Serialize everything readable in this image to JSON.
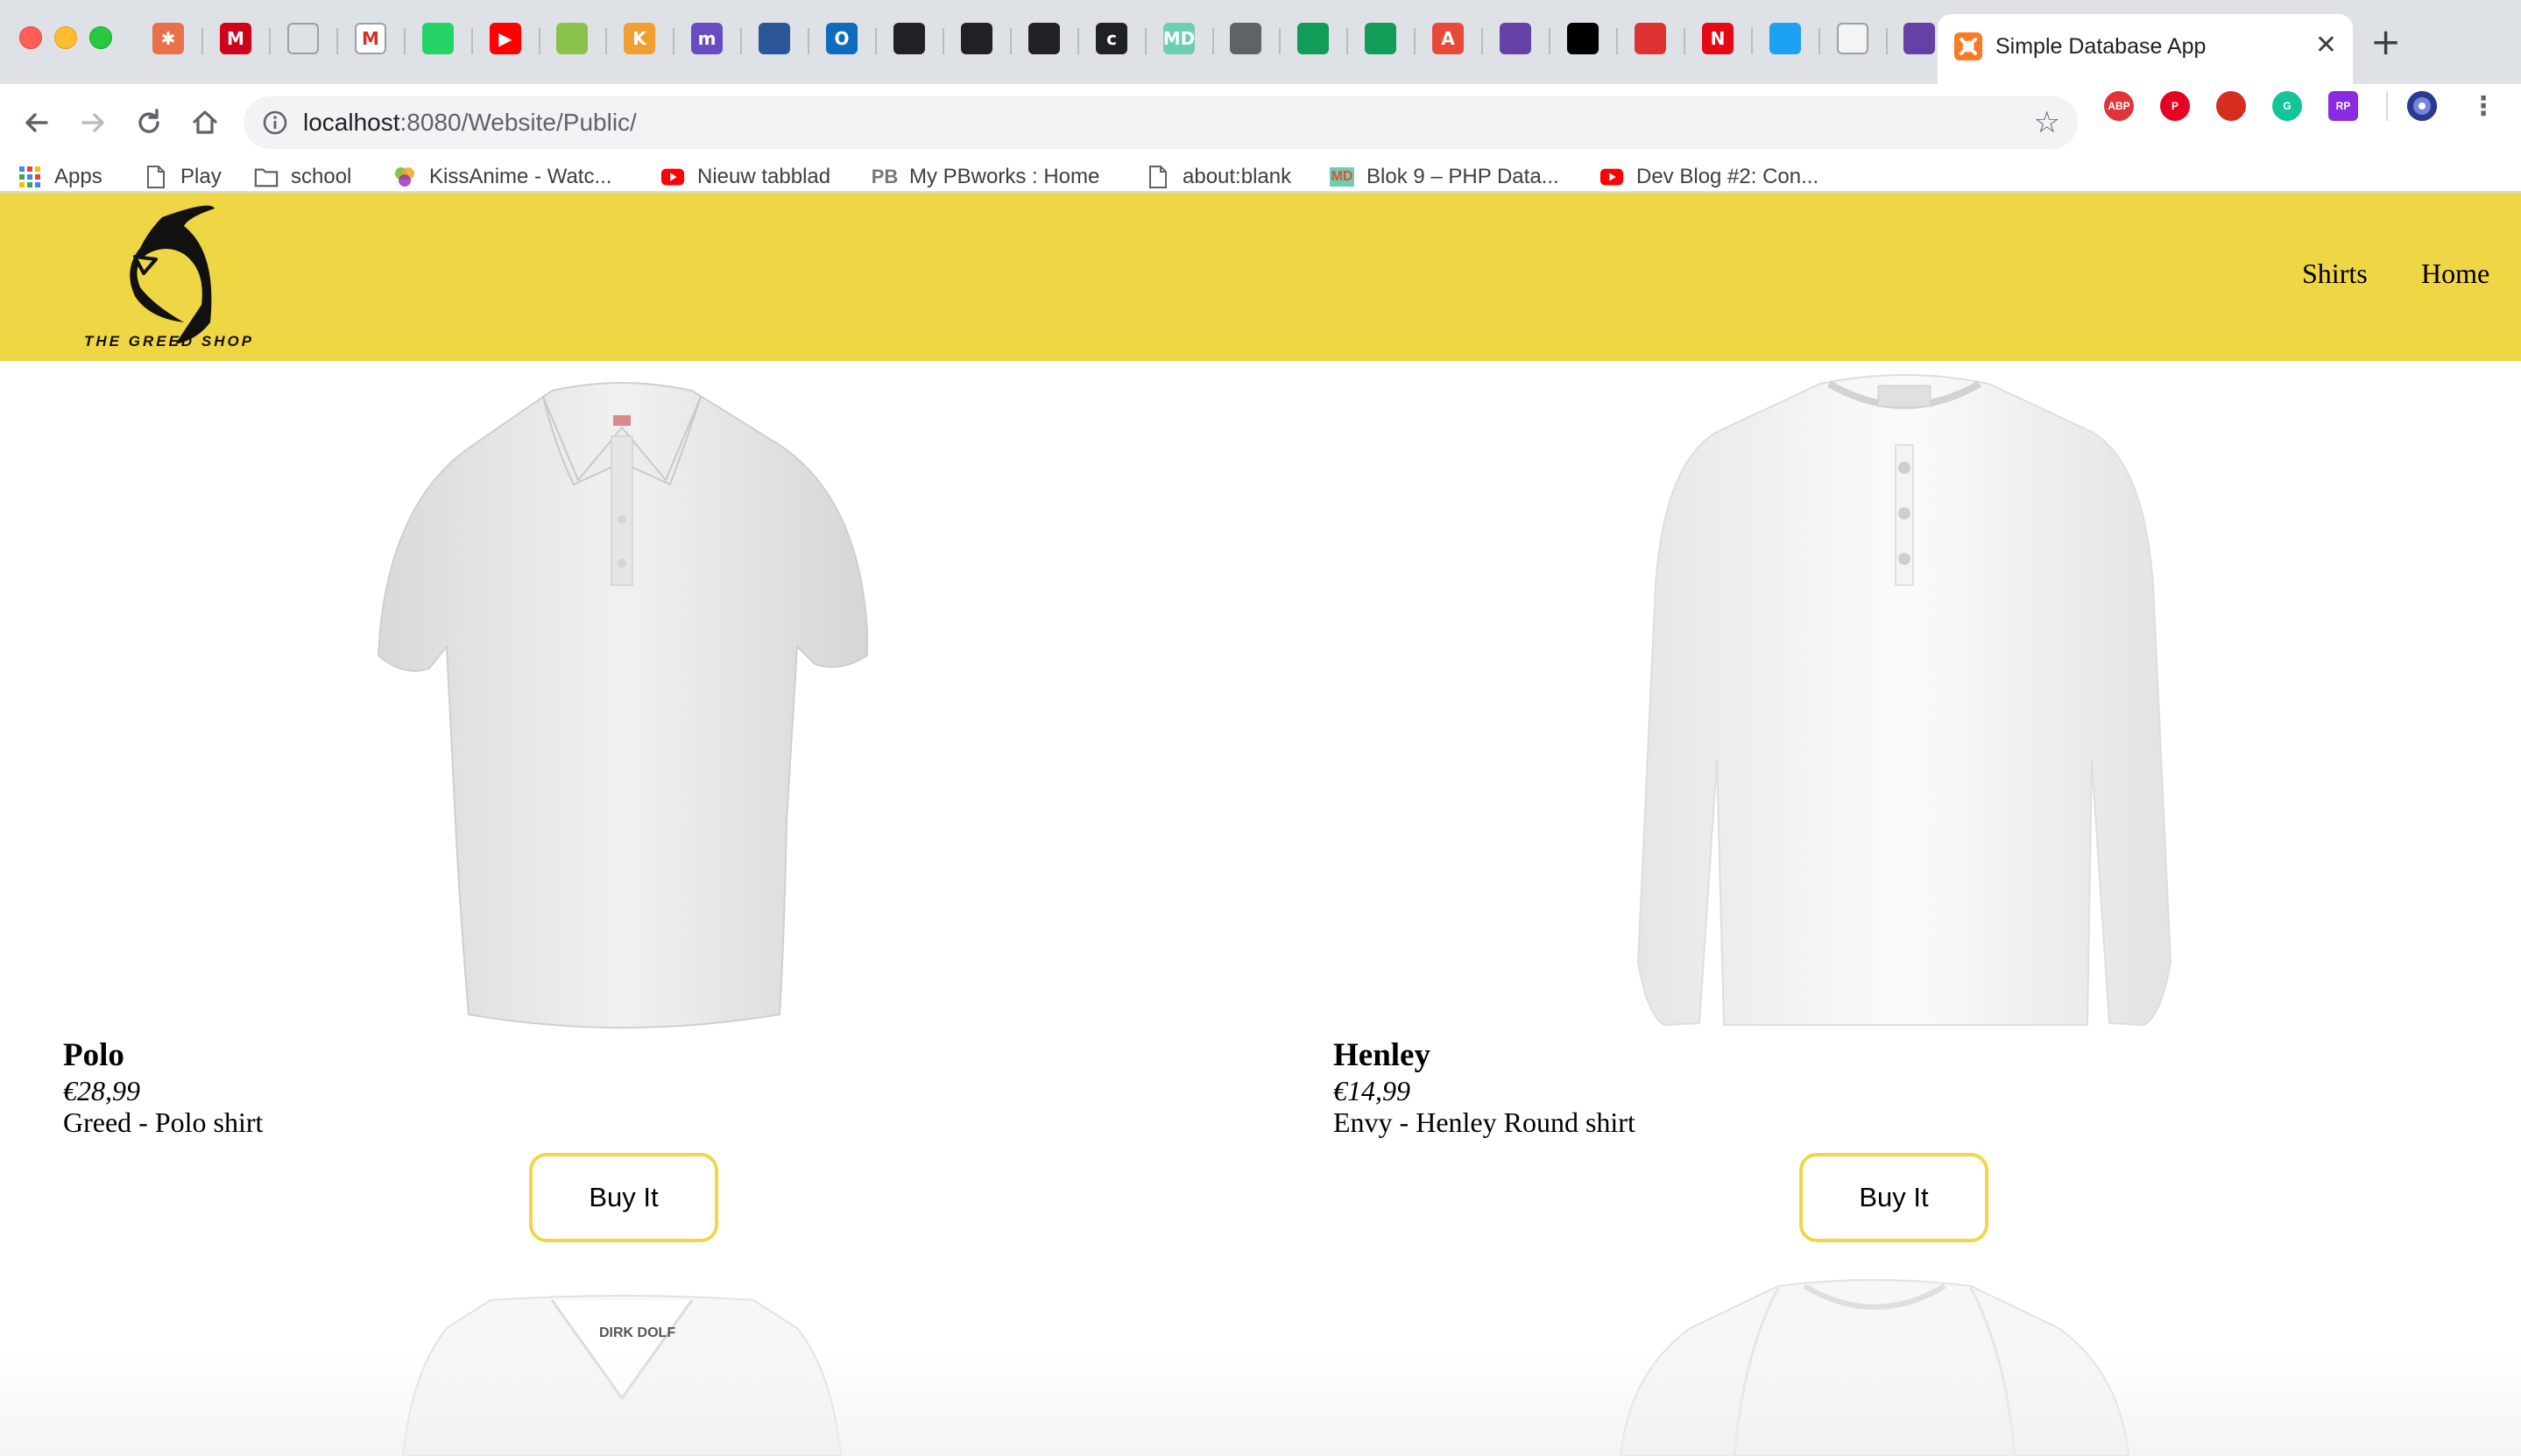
{
  "browser": {
    "pinned_tabs": [
      {
        "icon": "asterisk-app-icon",
        "color": "#e8704a",
        "glyph": "✱"
      },
      {
        "icon": "m-red-icon",
        "color": "#d0021b",
        "glyph": "M"
      },
      {
        "icon": "document-icon",
        "color": "#dee1e6",
        "glyph": ""
      },
      {
        "icon": "gmail-icon",
        "color": "#ffffff",
        "glyph": "M"
      },
      {
        "icon": "whatsapp-icon",
        "color": "#25d366",
        "glyph": ""
      },
      {
        "icon": "youtube-icon",
        "color": "#ff0000",
        "glyph": "▶"
      },
      {
        "icon": "kissanime-icon",
        "color": "#8bc34a",
        "glyph": ""
      },
      {
        "icon": "k-icon",
        "color": "#f0a030",
        "glyph": "K"
      },
      {
        "icon": "m-purple-icon",
        "color": "#6a4bc4",
        "glyph": "m"
      },
      {
        "icon": "blue-book-icon",
        "color": "#2b579a",
        "glyph": ""
      },
      {
        "icon": "outlook-icon",
        "color": "#0f6cbd",
        "glyph": "O"
      },
      {
        "icon": "panel-icon",
        "color": "#202124",
        "glyph": ""
      },
      {
        "icon": "board-icon",
        "color": "#202124",
        "glyph": ""
      },
      {
        "icon": "trello-icon",
        "color": "#202124",
        "glyph": ""
      },
      {
        "icon": "c-terminal-icon",
        "color": "#202124",
        "glyph": "c"
      },
      {
        "icon": "md-icon",
        "color": "#6ccfb0",
        "glyph": "MD"
      },
      {
        "icon": "cube-icon",
        "color": "#5f6368",
        "glyph": ""
      },
      {
        "icon": "sheets-icon",
        "color": "#0f9d58",
        "glyph": ""
      },
      {
        "icon": "sheets-icon-2",
        "color": "#0f9d58",
        "glyph": ""
      },
      {
        "icon": "a-red-icon",
        "color": "#e84a3a",
        "glyph": "A"
      },
      {
        "icon": "twitch-icon",
        "color": "#6441a5",
        "glyph": ""
      },
      {
        "icon": "github-icon",
        "color": "#000000",
        "glyph": ""
      },
      {
        "icon": "record-icon",
        "color": "#d33",
        "glyph": ""
      },
      {
        "icon": "netflix-icon",
        "color": "#e50914",
        "glyph": "N"
      },
      {
        "icon": "twitter-icon",
        "color": "#1da1f2",
        "glyph": ""
      },
      {
        "icon": "face-icon",
        "color": "#f4f4f4",
        "glyph": ""
      },
      {
        "icon": "twitch-icon-2",
        "color": "#6441a5",
        "glyph": ""
      }
    ],
    "active_tab": {
      "title": "Simple Database App"
    },
    "url": {
      "host": "localhost",
      "path": ":8080/Website/Public/"
    },
    "extensions": [
      {
        "icon": "adblock-icon",
        "color": "#e0343a",
        "label": "ABP"
      },
      {
        "icon": "pinterest-icon",
        "color": "#e60023",
        "label": "P"
      },
      {
        "icon": "hand-stop-icon",
        "color": "#d62d20",
        "label": ""
      },
      {
        "icon": "grammarly-icon",
        "color": "#15c39a",
        "label": "G"
      },
      {
        "icon": "rp-icon",
        "color": "#8a2be2",
        "label": "RP"
      }
    ],
    "bookmarks": [
      {
        "label": "Apps",
        "icon": "apps-grid-icon"
      },
      {
        "label": "Play",
        "icon": "document-icon"
      },
      {
        "label": "school",
        "icon": "folder-icon"
      },
      {
        "label": "KissAnime - Watc...",
        "icon": "kissanime-icon"
      },
      {
        "label": "Nieuw tabblad",
        "icon": "youtube-icon"
      },
      {
        "label": "My PBworks : Home",
        "icon": "pbworks-icon"
      },
      {
        "label": "about:blank",
        "icon": "document-icon"
      },
      {
        "label": "Blok 9 – PHP Data...",
        "icon": "md-icon"
      },
      {
        "label": "Dev Blog #2: Con...",
        "icon": "youtube-icon"
      }
    ]
  },
  "site": {
    "logo_text": "THE GREED SHOP",
    "nav": [
      {
        "label": "Shirts"
      },
      {
        "label": "Home"
      }
    ],
    "products": [
      {
        "name": "Polo",
        "price": "€28,99",
        "description": "Greed - Polo shirt",
        "button": "Buy It"
      },
      {
        "name": "Henley",
        "price": "€14,99",
        "description": "Envy - Henley Round shirt",
        "button": "Buy It"
      }
    ],
    "partial_products": [
      {
        "label": "DIRK DOLF"
      }
    ],
    "accent_color": "#efd645"
  }
}
